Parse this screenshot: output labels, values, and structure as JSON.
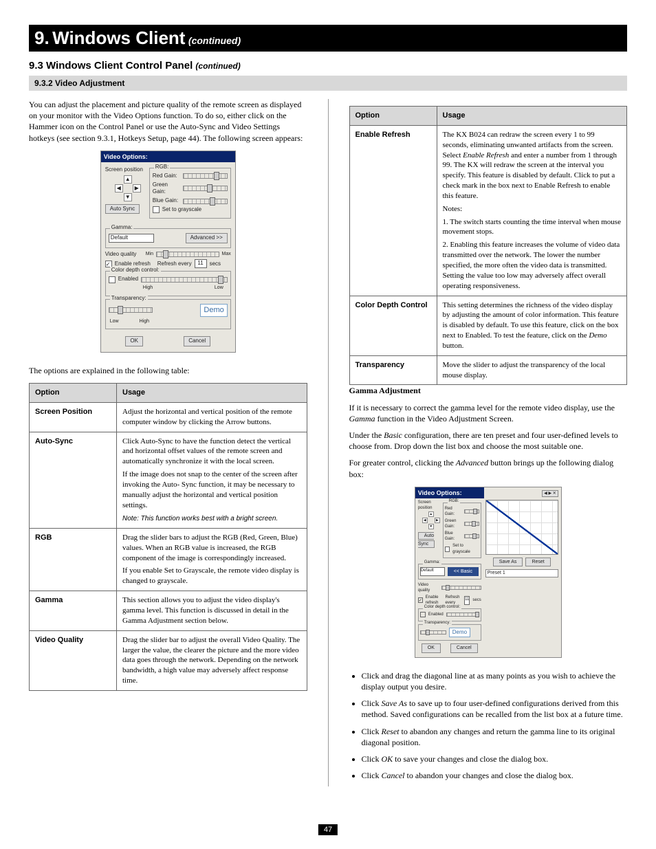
{
  "chapter": {
    "number": "9.",
    "title": "Windows Client",
    "continued": "(continued)"
  },
  "subchapter": {
    "number": "9.3",
    "title": "Windows Client Control Panel",
    "continued": "(continued)"
  },
  "subsub": "9.3.2 Video Adjustment",
  "intro1": "You can adjust the placement and picture quality of the remote screen as displayed on your monitor with the Video Options function. To do so, either click on the Hammer icon on the Control Panel or use the Auto-Sync and Video Settings hotkeys (see section 9.3.1, Hotkeys Setup,",
  "intro2": " page 44). The following screen appears:",
  "mock1": {
    "title": "Video Options:",
    "screen_position": "Screen position",
    "auto_sync": "Auto Sync",
    "rgb_legend": "RGB:",
    "red": "Red Gain:",
    "green": "Green Gain:",
    "blue": "Blue Gain:",
    "grayscale": "Set to grayscale",
    "gamma_legend": "Gamma:",
    "gamma_default": "Default",
    "advanced": "Advanced >>",
    "vq": "Video quality",
    "min": "Min",
    "max": "Max",
    "enable_refresh": "Enable refresh",
    "refresh_every": "Refresh every",
    "refresh_value": "11",
    "secs": "secs",
    "cdc_legend": "Color depth control:",
    "enabled": "Enabled",
    "high": "High",
    "low": "Low",
    "trans_legend": "Transparency:",
    "demo": "Demo",
    "ok": "OK",
    "cancel": "Cancel"
  },
  "leftTable": {
    "head_opt": "Option",
    "head_use": "Usage",
    "rows": [
      {
        "k": "Screen Position",
        "v": "Adjust the horizontal and vertical position of the remote computer window by clicking the Arrow buttons."
      },
      {
        "k": "Auto-Sync",
        "v": "Click Auto-Sync to have the function detect the vertical and horizontal offset values of the remote screen and automatically synchronize it with the local screen.\nIf the image does not snap to the center of the screen after invoking the Auto- Sync function, it may be necessary to manually adjust the horizontal and vertical position settings.",
        "note": "Note: This function works best with a bright screen."
      },
      {
        "k": "RGB",
        "v": "Drag the slider bars to adjust the RGB (Red, Green, Blue) values. When an RGB value is increased, the RGB component of the image is correspondingly increased.\nIf you enable Set to Grayscale, the remote video display is changed to grayscale."
      },
      {
        "k": "Gamma",
        "v": "This section allows you to adjust the video display's gamma level. This function is discussed in detail in the Gamma Adjustment section below."
      },
      {
        "k": "Video Quality",
        "v": "Drag the slider bar to adjust the overall Video Quality. The larger the value, the clearer the picture and the more video data goes through the network. Depending on the network bandwidth, a high value may adversely affect response time."
      }
    ]
  },
  "rightTable": {
    "head_opt": "Option",
    "head_use": "Usage",
    "rows": [
      {
        "k": "Enable Refresh",
        "v": "The KX B024 can redraw the screen every 1 to 99 seconds, eliminating unwanted artifacts from the screen. Select ",
        "em": "Enable Refresh",
        "v2": " and enter a number from 1 through 99. The KX will redraw the screen at the interval you specify. This feature is disabled by default. Click to put a check mark in the box next to Enable Refresh to enable this feature.\nNotes:\n1. The switch starts counting the time interval when mouse movement stops.\n2. Enabling this feature increases the volume of video data transmitted over the network. The lower the number specified, the more often the video data is transmitted. Setting the value too low may adversely affect overall operating responsiveness."
      },
      {
        "k": "Color Depth Control",
        "v": "This setting determines the richness of the video display by adjusting the amount of color information. This feature is disabled by default. To use this feature, click on the box next to Enabled. To test the feature, click on the ",
        "em": "Demo",
        "v2": " button."
      },
      {
        "k": "Transparency",
        "v": "Move the slider to adjust the transparency of the local mouse display."
      }
    ]
  },
  "gamma": {
    "heading": "Gamma Adjustment",
    "p1_a": "If it is necessary to correct the gamma level for the remote video display, use the ",
    "p1_em": "Gamma",
    "p1_b": " function in the Video Adjustment Screen.",
    "p2_a": "Under the ",
    "p2_em": "Basic",
    "p2_b": " configuration, there are ten preset and four user-defined levels to choose from. Drop down the list box and choose the most suitable one.",
    "p3_a": "For greater control, clicking the ",
    "p3_em": "Advanced",
    "p3_b": " button brings up the following dialog box:"
  },
  "mock2": {
    "save_as": "Save As",
    "reset": "Reset",
    "preset": "Preset 1"
  },
  "bullets": [
    {
      "a": "Click and drag the diagonal line at as many points as you wish to achieve the display output you desire."
    },
    {
      "a": "Click ",
      "em": "Save As",
      "b": " to save up to four user-defined configurations derived from this method. Saved configurations can be recalled from the list box at a future time."
    },
    {
      "a": "Click ",
      "em": "Reset",
      "b": " to abandon any changes and return the gamma line to its original diagonal position."
    },
    {
      "a": "Click ",
      "em": "OK",
      "b": " to save your changes and close the dialog box."
    },
    {
      "a": "Click ",
      "em": "Cancel",
      "b": " to abandon your changes and close the dialog box."
    }
  ],
  "page_number": "47"
}
